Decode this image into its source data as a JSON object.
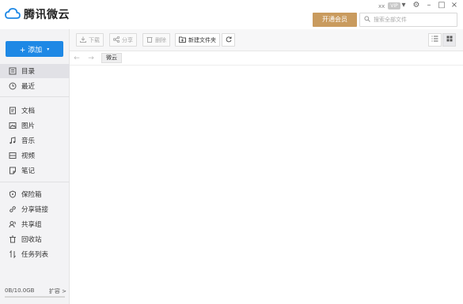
{
  "app": {
    "name": "腾讯微云"
  },
  "window": {
    "user": "xx",
    "vip_badge": "VIP",
    "controls": [
      "▾",
      "⚙",
      "–",
      "□",
      "×"
    ]
  },
  "header": {
    "vip_button": "开通会员",
    "search_placeholder": "搜索全部文件"
  },
  "sidebar": {
    "add_label": "+ 添加",
    "add_caret": "▾",
    "items": [
      {
        "label": "目录",
        "icon": "list-box-icon"
      },
      {
        "label": "最近",
        "icon": "clock-icon"
      },
      {
        "label": "文档",
        "icon": "document-icon"
      },
      {
        "label": "图片",
        "icon": "image-icon"
      },
      {
        "label": "音乐",
        "icon": "music-note-icon"
      },
      {
        "label": "视频",
        "icon": "video-icon"
      },
      {
        "label": "笔记",
        "icon": "note-icon"
      },
      {
        "label": "保险箱",
        "icon": "shield-icon"
      },
      {
        "label": "分享链接",
        "icon": "link-icon"
      },
      {
        "label": "共享组",
        "icon": "group-icon"
      },
      {
        "label": "回收站",
        "icon": "trash-icon"
      },
      {
        "label": "任务列表",
        "icon": "transfer-icon"
      }
    ],
    "active_index": 0,
    "storage": {
      "used_text": "0B/10.0GB",
      "expand_label": "扩容 >",
      "used_fraction": 0.0
    }
  },
  "toolbar": {
    "download_label": "下载",
    "share_label": "分享",
    "delete_label": "删除",
    "new_folder_label": "新建文件夹",
    "refresh_icon": "refresh-icon",
    "list_view_icon": "list-view-icon",
    "grid_view_icon": "grid-view-icon"
  },
  "breadcrumb": {
    "back": "←",
    "forward": "→",
    "items": [
      "微云"
    ]
  },
  "colors": {
    "accent": "#1e88e5",
    "vip": "#c99b5e",
    "sidebar_bg": "#f3f3f5"
  }
}
